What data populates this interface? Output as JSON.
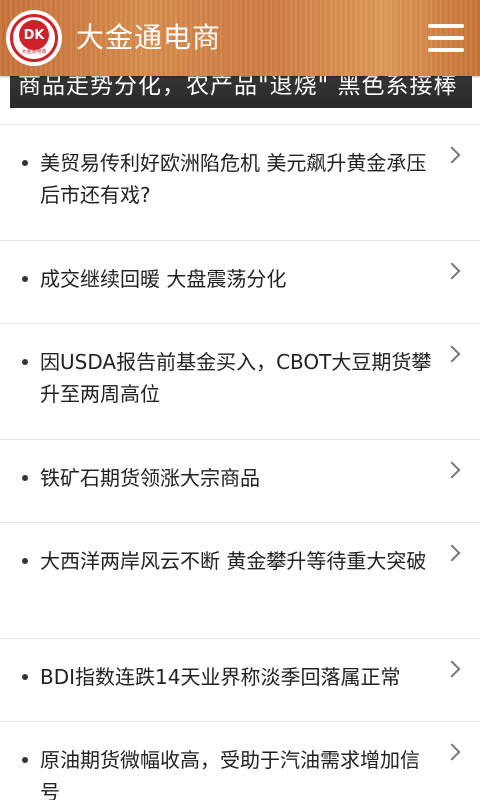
{
  "header": {
    "logo_letters": "DK",
    "logo_caption": "大金通电商",
    "title": "大金通电商",
    "menu_icon": "hamburger-menu-icon"
  },
  "banner": {
    "text": "商品走势分化，农产品\"退烧\" 黑色系接棒"
  },
  "news": [
    {
      "title": "美贸易传利好欧洲陷危机 美元飙升黄金承压后市还有戏?"
    },
    {
      "title": "成交继续回暖 大盘震荡分化"
    },
    {
      "title": "因USDA报告前基金买入，CBOT大豆期货攀升至两周高位"
    },
    {
      "title": "铁矿石期货领涨大宗商品"
    },
    {
      "title": "大西洋两岸风云不断 黄金攀升等待重大突破"
    },
    {
      "title": "BDI指数连跌14天业界称淡季回落属正常"
    },
    {
      "title": "原油期货微幅收高，受助于汽油需求增加信号"
    }
  ],
  "colors": {
    "header_bg": "#d08540",
    "logo_red": "#d0202a",
    "text": "#222222",
    "divider": "#e4e4e4"
  }
}
